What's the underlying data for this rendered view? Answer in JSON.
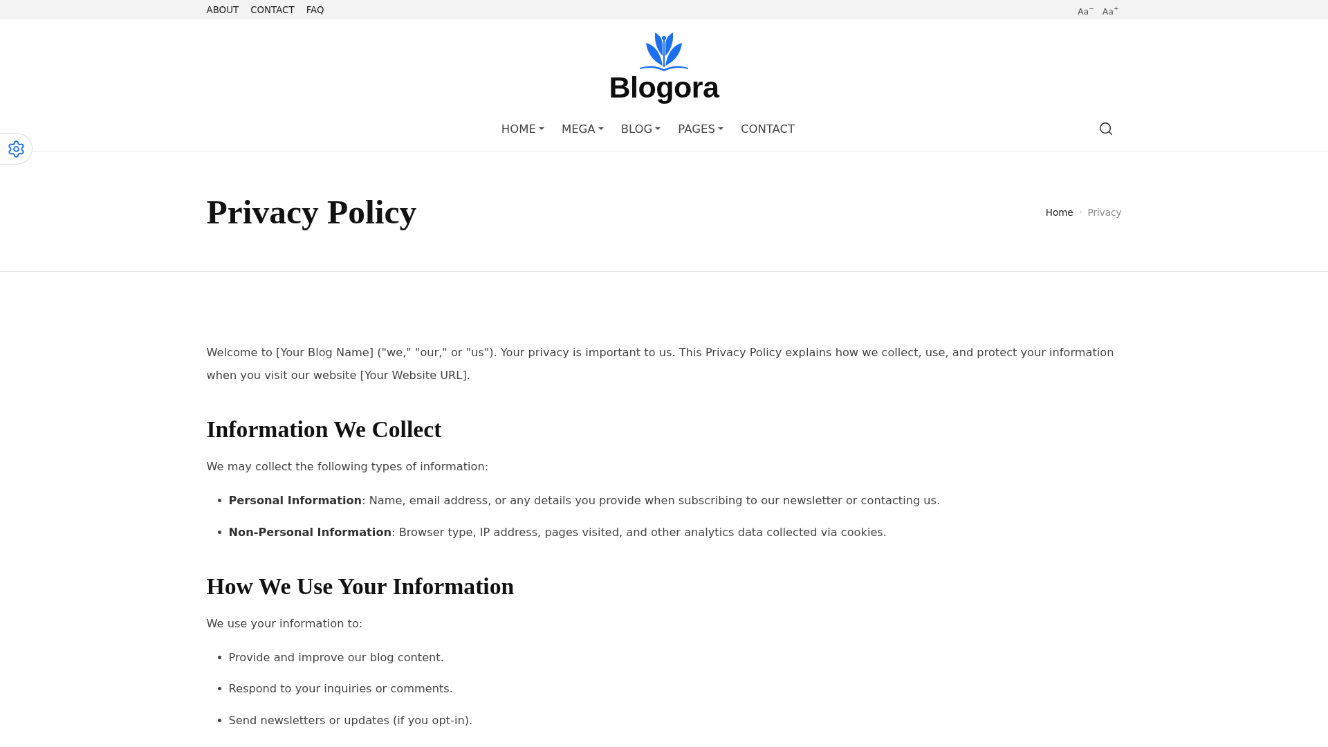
{
  "top_bar": {
    "links": [
      "ABOUT",
      "CONTACT",
      "FAQ"
    ],
    "font_controls": [
      "Aa$^{−}$",
      "Aa$^{+}$"
    ]
  },
  "header": {
    "logo_text": "Blogora",
    "nav": [
      {
        "label": "HOME",
        "has_menu": true
      },
      {
        "label": "MEGA",
        "has_menu": true
      },
      {
        "label": "BLOG",
        "has_menu": true
      },
      {
        "label": "PAGES",
        "has_menu": true
      },
      {
        "label": "CONTACT",
        "has_menu": false
      }
    ]
  },
  "page_title": "Privacy Policy",
  "breadcrumb": [
    {
      "label": "Home",
      "current": false
    },
    {
      "label": "Privacy",
      "current": true
    }
  ],
  "content": [
    {
      "kind": "paragraph",
      "text": "Welcome to [Your Blog Name] (\"we,\" \"our,\" or \"us\"). Your privacy is important to us. This Privacy Policy explains how we collect, use, and protect your information when you visit our website [Your Website URL]."
    },
    {
      "kind": "heading",
      "text": "Information We Collect"
    },
    {
      "kind": "paragraph",
      "text": "We may collect the following types of information:"
    },
    {
      "kind": "list",
      "items": [
        "**Personal Information**: Name, email address, or any details you provide when subscribing to our newsletter or contacting us.",
        "**Non-Personal Information**: Browser type, IP address, pages visited, and other analytics data collected via cookies."
      ]
    },
    {
      "kind": "heading",
      "text": "How We Use Your Information"
    },
    {
      "kind": "paragraph",
      "text": "We use your information to:"
    },
    {
      "kind": "list",
      "items": [
        "Provide and improve our blog content.",
        "Respond to your inquiries or comments.",
        "Send newsletters or updates (if you opt-in)."
      ]
    }
  ]
}
